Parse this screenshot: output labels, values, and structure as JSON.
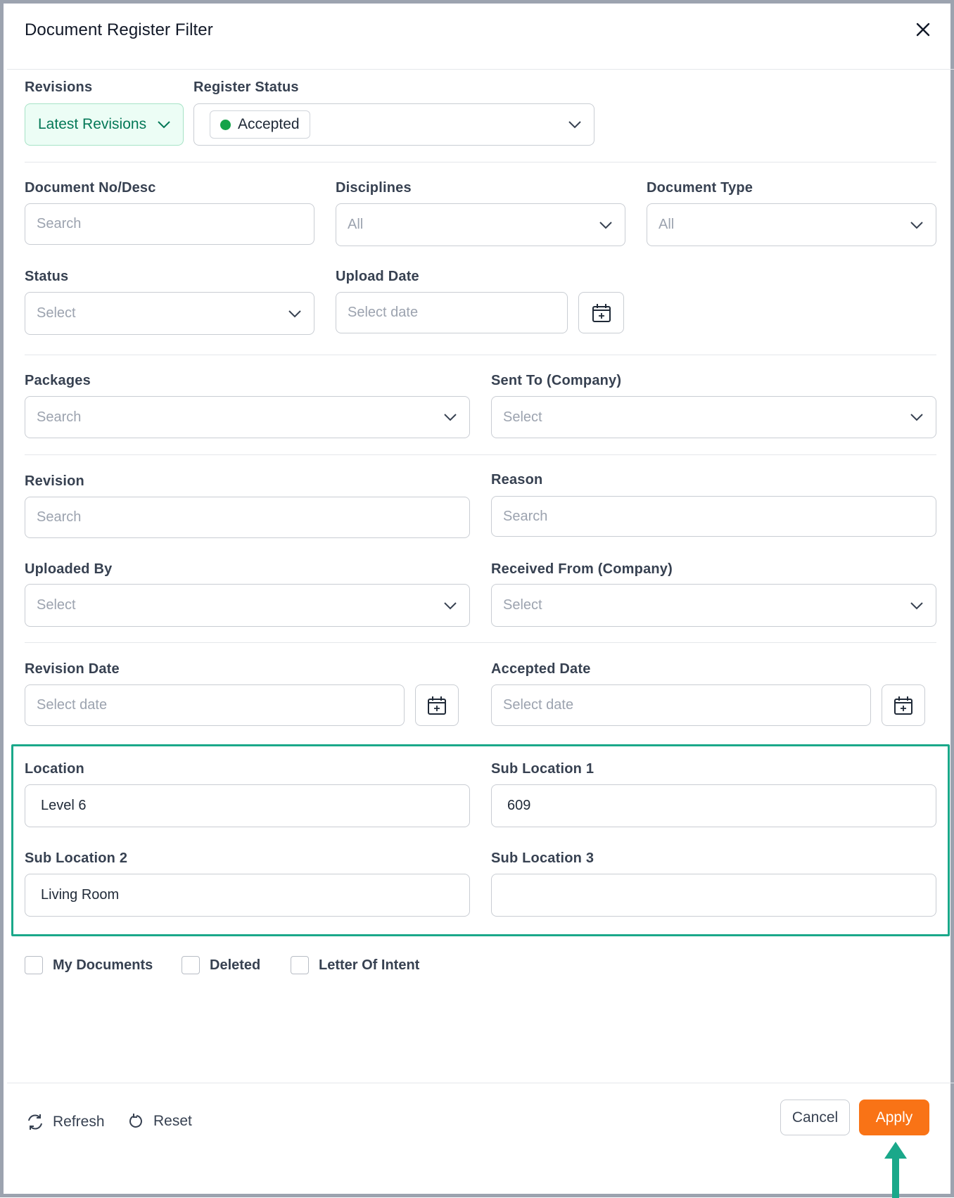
{
  "dialog": {
    "title": "Document Register Filter"
  },
  "revisions": {
    "label": "Revisions",
    "value": "Latest Revisions"
  },
  "register_status": {
    "label": "Register Status",
    "tag": "Accepted",
    "tag_color": "#16a34a"
  },
  "doc_no": {
    "label": "Document No/Desc",
    "placeholder": "Search"
  },
  "disciplines": {
    "label": "Disciplines",
    "placeholder": "All"
  },
  "doc_type": {
    "label": "Document Type",
    "placeholder": "All"
  },
  "status": {
    "label": "Status",
    "placeholder": "Select"
  },
  "upload_date": {
    "label": "Upload Date",
    "placeholder": "Select date"
  },
  "packages": {
    "label": "Packages",
    "placeholder": "Search"
  },
  "sent_to": {
    "label": "Sent To (Company)",
    "placeholder": "Select"
  },
  "revision": {
    "label": "Revision",
    "placeholder": "Search"
  },
  "reason": {
    "label": "Reason",
    "placeholder": "Search"
  },
  "uploaded_by": {
    "label": "Uploaded By",
    "placeholder": "Select"
  },
  "received_from": {
    "label": "Received From (Company)",
    "placeholder": "Select"
  },
  "revision_date": {
    "label": "Revision Date",
    "placeholder": "Select date"
  },
  "accepted_date": {
    "label": "Accepted Date",
    "placeholder": "Select date"
  },
  "location": {
    "label": "Location",
    "value": "Level 6"
  },
  "sub_location_1": {
    "label": "Sub Location 1",
    "value": "609"
  },
  "sub_location_2": {
    "label": "Sub Location 2",
    "value": "Living Room"
  },
  "sub_location_3": {
    "label": "Sub Location 3",
    "value": ""
  },
  "checkboxes": {
    "my_documents": "My Documents",
    "deleted": "Deleted",
    "letter_of_intent": "Letter Of Intent"
  },
  "footer": {
    "refresh": "Refresh",
    "reset": "Reset",
    "cancel": "Cancel",
    "apply": "Apply"
  },
  "colors": {
    "accent_orange": "#f97316",
    "highlight_teal": "#1aa88a",
    "revisions_green": "#047857"
  }
}
